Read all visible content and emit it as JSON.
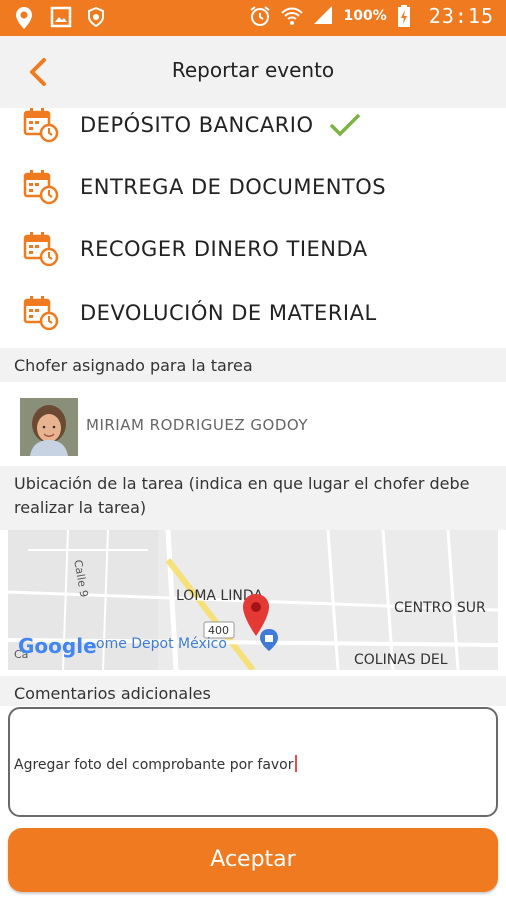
{
  "status_bar": {
    "battery": "100%",
    "time": "23:15",
    "icons": [
      "location-icon",
      "image-icon",
      "shield-icon",
      "alarm-icon",
      "wifi-icon",
      "signal-icon",
      "battery-charging-icon"
    ]
  },
  "toolbar": {
    "title": "Reportar evento",
    "back_icon": "chevron-left-icon"
  },
  "events": [
    {
      "label": "DEPÓSITO BANCARIO",
      "icon": "calendar-clock-icon",
      "selected": true
    },
    {
      "label": "ENTREGA DE DOCUMENTOS",
      "icon": "calendar-clock-icon",
      "selected": false
    },
    {
      "label": "RECOGER DINERO TIENDA",
      "icon": "calendar-clock-icon",
      "selected": false
    },
    {
      "label": "DEVOLUCIÓN DE MATERIAL",
      "icon": "calendar-clock-icon",
      "selected": false
    }
  ],
  "driver_section": {
    "header": "Chofer asignado para la tarea",
    "name": "MIRIAM RODRIGUEZ GODOY"
  },
  "location_section": {
    "header": "Ubicación de la tarea (indica en que lugar el chofer debe realizar la tarea)",
    "map": {
      "labels": {
        "loma": "LOMA LINDA",
        "centro": "CENTRO SUR",
        "colinas": "COLINAS DEL",
        "home_depot": "ome Depot México",
        "calle": "Calle 9",
        "road_number": "400",
        "google": "Google",
        "ca": "Ca"
      }
    }
  },
  "comments_section": {
    "header": "Comentarios adicionales",
    "value": "Agregar foto del comprobante por favor"
  },
  "accept_button": {
    "label": "Aceptar"
  },
  "colors": {
    "accent": "#ef7a1f",
    "check": "#7cb342",
    "pin": "#e53935"
  }
}
